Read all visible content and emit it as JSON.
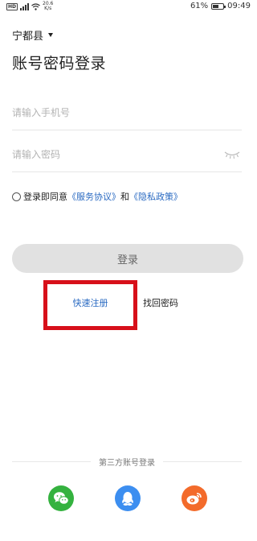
{
  "status_bar": {
    "network_badge": "HD",
    "speed_value": "20.6",
    "speed_unit": "K/s",
    "battery_percent": "61%",
    "battery_level": 0.61,
    "time": "09:49"
  },
  "location": "宁都县",
  "title": "账号密码登录",
  "phone_placeholder": "请输入手机号",
  "password_placeholder": "请输入密码",
  "agreement": {
    "prefix": "登录即同意",
    "service": "《服务协议》",
    "and": "和",
    "privacy": "《隐私政策》"
  },
  "login_label": "登录",
  "register_label": "快速注册",
  "forgot_label": "找回密码",
  "third_party_label": "第三方账号登录",
  "icons": {
    "location_dropdown": "chevron-down-icon",
    "password_toggle": "eye-closed-icon",
    "wechat": "wechat-icon",
    "qq": "qq-icon",
    "weibo": "weibo-icon"
  },
  "colors": {
    "link": "#2a6ac2",
    "highlight_box": "#d7101a",
    "wechat": "#34b23f",
    "qq": "#3c8ef0",
    "weibo": "#f36b2b",
    "login_button": "#e1e1e1"
  }
}
